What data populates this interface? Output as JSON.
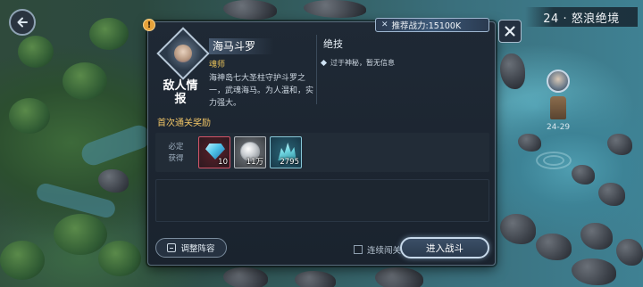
{
  "stage": {
    "title": "24 · 怒浪绝境",
    "node_label": "24-29"
  },
  "power": {
    "label": "推荐战力:15100K"
  },
  "enemy": {
    "tag": "敌人情报",
    "name": "海马斗罗",
    "role": "魂师",
    "description": "海神岛七大圣柱守护斗罗之一，武魂海马。为人温和，实力强大。"
  },
  "skill": {
    "title": "绝技",
    "info": "过于神秘，暂无信息"
  },
  "reward": {
    "title": "首次通关奖励",
    "guaranteed_label": "必定获得",
    "items": [
      {
        "icon": "diamond-gem-icon",
        "quantity": "10",
        "color": "#d45468"
      },
      {
        "icon": "silver-coin-icon",
        "quantity": "11万",
        "color": "#b3b8bd"
      },
      {
        "icon": "soul-crystal-icon",
        "quantity": "2795",
        "color": "#88c8d8"
      }
    ]
  },
  "actions": {
    "adjust_lineup": "调整阵容",
    "auto_battle": "连续闯关",
    "enter_battle": "进入战斗"
  },
  "icons": {
    "back": "back-arrow-icon",
    "close": "close-icon",
    "warning": "!"
  }
}
